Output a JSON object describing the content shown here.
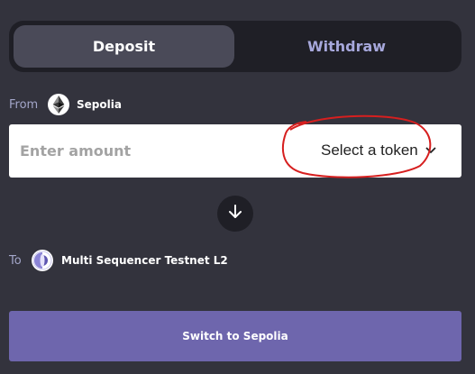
{
  "tabs": {
    "deposit_label": "Deposit",
    "withdraw_label": "Withdraw",
    "active": "Deposit"
  },
  "from": {
    "label": "From",
    "network": "Sepolia",
    "icon": "ethereum-icon"
  },
  "amount": {
    "placeholder": "Enter amount",
    "value": ""
  },
  "token_select": {
    "label": "Select a token",
    "icon": "chevron-down-icon"
  },
  "to": {
    "label": "To",
    "network": "Multi Sequencer Testnet L2",
    "icon": "multi-sequencer-logo-icon"
  },
  "switch_button": {
    "label": "Switch to Sepolia"
  },
  "colors": {
    "background": "#33333d",
    "tab_track": "#1f1f26",
    "active_tab": "#4a4a58",
    "inactive_tab_text": "#a7a8dc",
    "label_text": "#a3a6c9",
    "primary_button": "#6e66ad",
    "annotation": "#d61f1f"
  }
}
